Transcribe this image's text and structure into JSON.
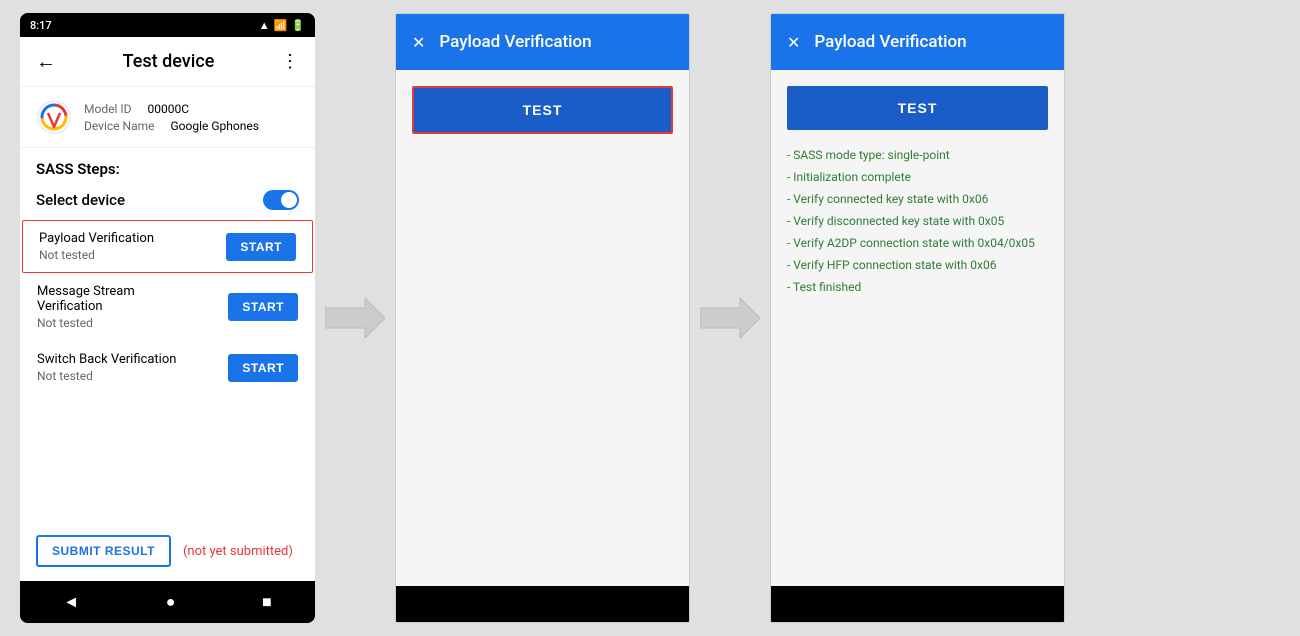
{
  "phone": {
    "status_bar": {
      "time": "8:17",
      "icons": "📶🔋"
    },
    "header": {
      "title": "Test device",
      "back_label": "←",
      "more_label": "⋮"
    },
    "device_info": {
      "model_id_label": "Model ID",
      "model_id_value": "00000C",
      "device_name_label": "Device Name",
      "device_name_value": "Google Gphones"
    },
    "sass_steps_label": "SASS Steps:",
    "select_device_label": "Select device",
    "test_rows": [
      {
        "name": "Payload Verification",
        "status": "Not tested",
        "start_label": "START",
        "highlighted": true
      },
      {
        "name": "Message Stream Verification",
        "status": "Not tested",
        "start_label": "START",
        "highlighted": false
      },
      {
        "name": "Switch Back Verification",
        "status": "Not tested",
        "start_label": "START",
        "highlighted": false
      }
    ],
    "submit_label": "SUBMIT RESULT",
    "not_submitted_label": "(not yet submitted)",
    "nav": {
      "back": "◄",
      "home": "●",
      "square": "■"
    }
  },
  "dialog1": {
    "title": "Payload Verification",
    "close_icon": "✕",
    "test_btn_label": "TEST",
    "has_outline": true
  },
  "dialog2": {
    "title": "Payload Verification",
    "close_icon": "✕",
    "test_btn_label": "TEST",
    "has_outline": false,
    "results": [
      "- SASS mode type: single-point",
      "- Initialization complete",
      "- Verify connected key state with 0x06",
      "- Verify disconnected key state with 0x05",
      "- Verify A2DP connection state with 0x04/0x05",
      "- Verify HFP connection state with 0x06",
      "- Test finished"
    ]
  },
  "arrow": {
    "label": "→"
  }
}
